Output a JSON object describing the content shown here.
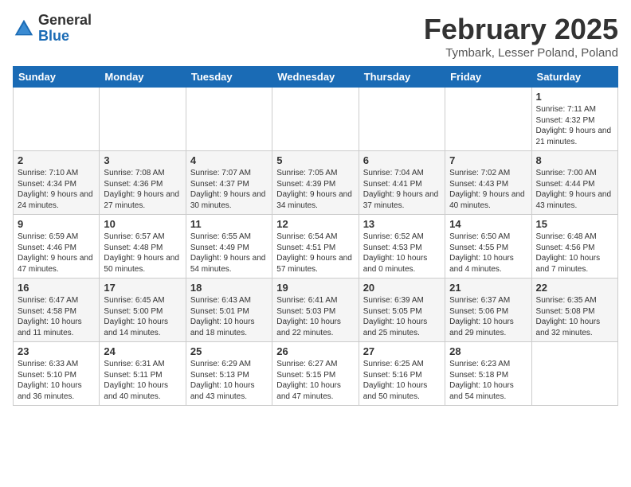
{
  "logo": {
    "general": "General",
    "blue": "Blue"
  },
  "title": "February 2025",
  "location": "Tymbark, Lesser Poland, Poland",
  "weekdays": [
    "Sunday",
    "Monday",
    "Tuesday",
    "Wednesday",
    "Thursday",
    "Friday",
    "Saturday"
  ],
  "weeks": [
    [
      {
        "day": "",
        "info": ""
      },
      {
        "day": "",
        "info": ""
      },
      {
        "day": "",
        "info": ""
      },
      {
        "day": "",
        "info": ""
      },
      {
        "day": "",
        "info": ""
      },
      {
        "day": "",
        "info": ""
      },
      {
        "day": "1",
        "info": "Sunrise: 7:11 AM\nSunset: 4:32 PM\nDaylight: 9 hours and 21 minutes."
      }
    ],
    [
      {
        "day": "2",
        "info": "Sunrise: 7:10 AM\nSunset: 4:34 PM\nDaylight: 9 hours and 24 minutes."
      },
      {
        "day": "3",
        "info": "Sunrise: 7:08 AM\nSunset: 4:36 PM\nDaylight: 9 hours and 27 minutes."
      },
      {
        "day": "4",
        "info": "Sunrise: 7:07 AM\nSunset: 4:37 PM\nDaylight: 9 hours and 30 minutes."
      },
      {
        "day": "5",
        "info": "Sunrise: 7:05 AM\nSunset: 4:39 PM\nDaylight: 9 hours and 34 minutes."
      },
      {
        "day": "6",
        "info": "Sunrise: 7:04 AM\nSunset: 4:41 PM\nDaylight: 9 hours and 37 minutes."
      },
      {
        "day": "7",
        "info": "Sunrise: 7:02 AM\nSunset: 4:43 PM\nDaylight: 9 hours and 40 minutes."
      },
      {
        "day": "8",
        "info": "Sunrise: 7:00 AM\nSunset: 4:44 PM\nDaylight: 9 hours and 43 minutes."
      }
    ],
    [
      {
        "day": "9",
        "info": "Sunrise: 6:59 AM\nSunset: 4:46 PM\nDaylight: 9 hours and 47 minutes."
      },
      {
        "day": "10",
        "info": "Sunrise: 6:57 AM\nSunset: 4:48 PM\nDaylight: 9 hours and 50 minutes."
      },
      {
        "day": "11",
        "info": "Sunrise: 6:55 AM\nSunset: 4:49 PM\nDaylight: 9 hours and 54 minutes."
      },
      {
        "day": "12",
        "info": "Sunrise: 6:54 AM\nSunset: 4:51 PM\nDaylight: 9 hours and 57 minutes."
      },
      {
        "day": "13",
        "info": "Sunrise: 6:52 AM\nSunset: 4:53 PM\nDaylight: 10 hours and 0 minutes."
      },
      {
        "day": "14",
        "info": "Sunrise: 6:50 AM\nSunset: 4:55 PM\nDaylight: 10 hours and 4 minutes."
      },
      {
        "day": "15",
        "info": "Sunrise: 6:48 AM\nSunset: 4:56 PM\nDaylight: 10 hours and 7 minutes."
      }
    ],
    [
      {
        "day": "16",
        "info": "Sunrise: 6:47 AM\nSunset: 4:58 PM\nDaylight: 10 hours and 11 minutes."
      },
      {
        "day": "17",
        "info": "Sunrise: 6:45 AM\nSunset: 5:00 PM\nDaylight: 10 hours and 14 minutes."
      },
      {
        "day": "18",
        "info": "Sunrise: 6:43 AM\nSunset: 5:01 PM\nDaylight: 10 hours and 18 minutes."
      },
      {
        "day": "19",
        "info": "Sunrise: 6:41 AM\nSunset: 5:03 PM\nDaylight: 10 hours and 22 minutes."
      },
      {
        "day": "20",
        "info": "Sunrise: 6:39 AM\nSunset: 5:05 PM\nDaylight: 10 hours and 25 minutes."
      },
      {
        "day": "21",
        "info": "Sunrise: 6:37 AM\nSunset: 5:06 PM\nDaylight: 10 hours and 29 minutes."
      },
      {
        "day": "22",
        "info": "Sunrise: 6:35 AM\nSunset: 5:08 PM\nDaylight: 10 hours and 32 minutes."
      }
    ],
    [
      {
        "day": "23",
        "info": "Sunrise: 6:33 AM\nSunset: 5:10 PM\nDaylight: 10 hours and 36 minutes."
      },
      {
        "day": "24",
        "info": "Sunrise: 6:31 AM\nSunset: 5:11 PM\nDaylight: 10 hours and 40 minutes."
      },
      {
        "day": "25",
        "info": "Sunrise: 6:29 AM\nSunset: 5:13 PM\nDaylight: 10 hours and 43 minutes."
      },
      {
        "day": "26",
        "info": "Sunrise: 6:27 AM\nSunset: 5:15 PM\nDaylight: 10 hours and 47 minutes."
      },
      {
        "day": "27",
        "info": "Sunrise: 6:25 AM\nSunset: 5:16 PM\nDaylight: 10 hours and 50 minutes."
      },
      {
        "day": "28",
        "info": "Sunrise: 6:23 AM\nSunset: 5:18 PM\nDaylight: 10 hours and 54 minutes."
      },
      {
        "day": "",
        "info": ""
      }
    ]
  ]
}
